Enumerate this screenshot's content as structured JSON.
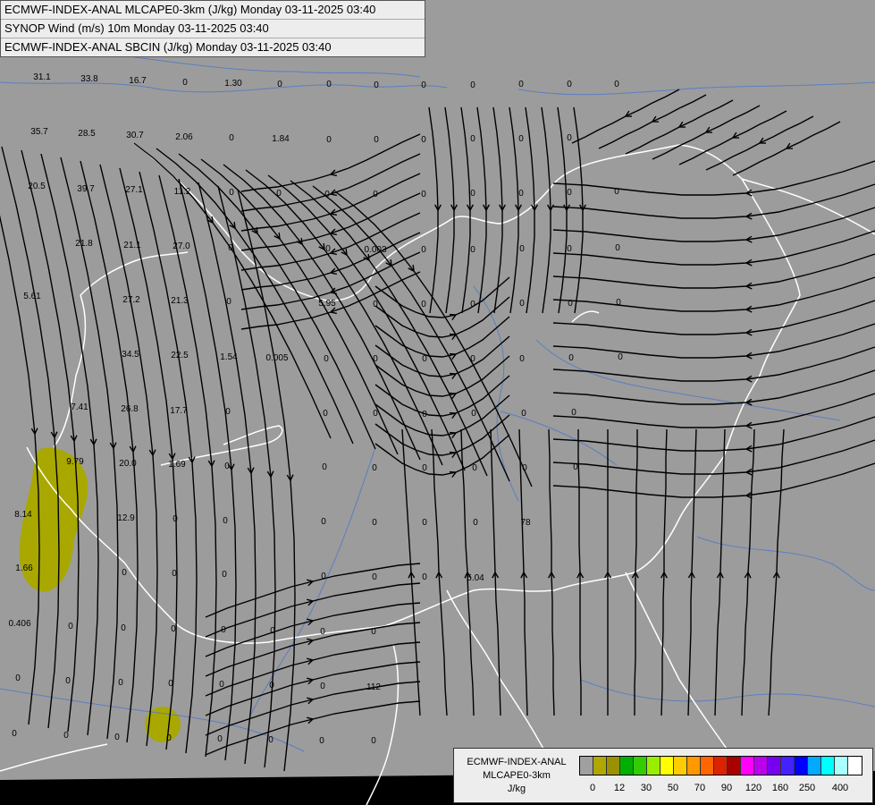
{
  "titles": {
    "line1": "ECMWF-INDEX-ANAL MLCAPE0-3km (J/kg) Monday 03-11-2025 03:40",
    "line2": "SYNOP Wind (m/s) 10m Monday 03-11-2025 03:40",
    "line3": "ECMWF-INDEX-ANAL SBCIN (J/kg) Monday 03-11-2025 03:40"
  },
  "legend": {
    "line1": "ECMWF-INDEX-ANAL",
    "line2": "MLCAPE0-3km",
    "unit": "J/kg",
    "colors": [
      "#a0a0a0",
      "#b0a800",
      "#9a9000",
      "#00b000",
      "#33cc00",
      "#99ee00",
      "#ffff00",
      "#ffcc00",
      "#ff9900",
      "#ff6600",
      "#dd2200",
      "#aa0000",
      "#ff00ff",
      "#bb00ee",
      "#7700ee",
      "#4422ff",
      "#0000ff",
      "#00aaff",
      "#00ffff",
      "#aaffff",
      "#ffffff"
    ],
    "tick_labels": [
      "0",
      "12",
      "30",
      "50",
      "70",
      "90",
      "120",
      "160",
      "250",
      "400"
    ]
  },
  "map": {
    "colors": {
      "background": "#9c9c9c",
      "streamlines": "#000000",
      "border": "#ffffff",
      "river": "#5a7fc0",
      "cape_fill": "#a8a800"
    },
    "values": [
      "31.1",
      "33.8",
      "16.7",
      "0",
      "1.30",
      "0",
      "0",
      "0",
      "0",
      "0",
      "0",
      "0",
      "0",
      "35.7",
      "28.5",
      "30.7",
      "2.06",
      "0",
      "1.84",
      "0",
      "0",
      "0",
      "0",
      "0",
      "0",
      "20.5",
      "39.7",
      "27.1",
      "11.2",
      "0",
      "0",
      "0",
      "0",
      "0",
      "0",
      "0",
      "0",
      "0",
      "21.8",
      "21.1",
      "27.0",
      "0",
      "0",
      "0.003",
      "0",
      "0",
      "0",
      "0",
      "0",
      "5.61",
      "27.2",
      "21.3",
      "0",
      "5.95",
      "0",
      "0",
      "0",
      "0",
      "0",
      "0",
      "34.5",
      "22.5",
      "1.54",
      "0.005",
      "0",
      "0",
      "0",
      "0",
      "0",
      "0",
      "0",
      "7.41",
      "26.8",
      "17.7",
      "0",
      "0",
      "0",
      "0",
      "0",
      "0",
      "0",
      "9.79",
      "20.0",
      "1.69",
      "0",
      "0",
      "0",
      "0",
      "0",
      "0",
      "0",
      "8.14",
      "12.9",
      "0",
      "0",
      "0",
      "0",
      "0",
      "0",
      "78",
      "1.66",
      "0",
      "0",
      "0",
      "0",
      "0",
      "0",
      "5.04",
      "0.406",
      "0",
      "0",
      "0",
      "0",
      "0",
      "0",
      "0",
      "0",
      "0",
      "0",
      "0",
      "0",
      "0",
      "0",
      "112",
      "0",
      "0",
      "0",
      "0",
      "0",
      "0",
      "0",
      "0"
    ]
  }
}
